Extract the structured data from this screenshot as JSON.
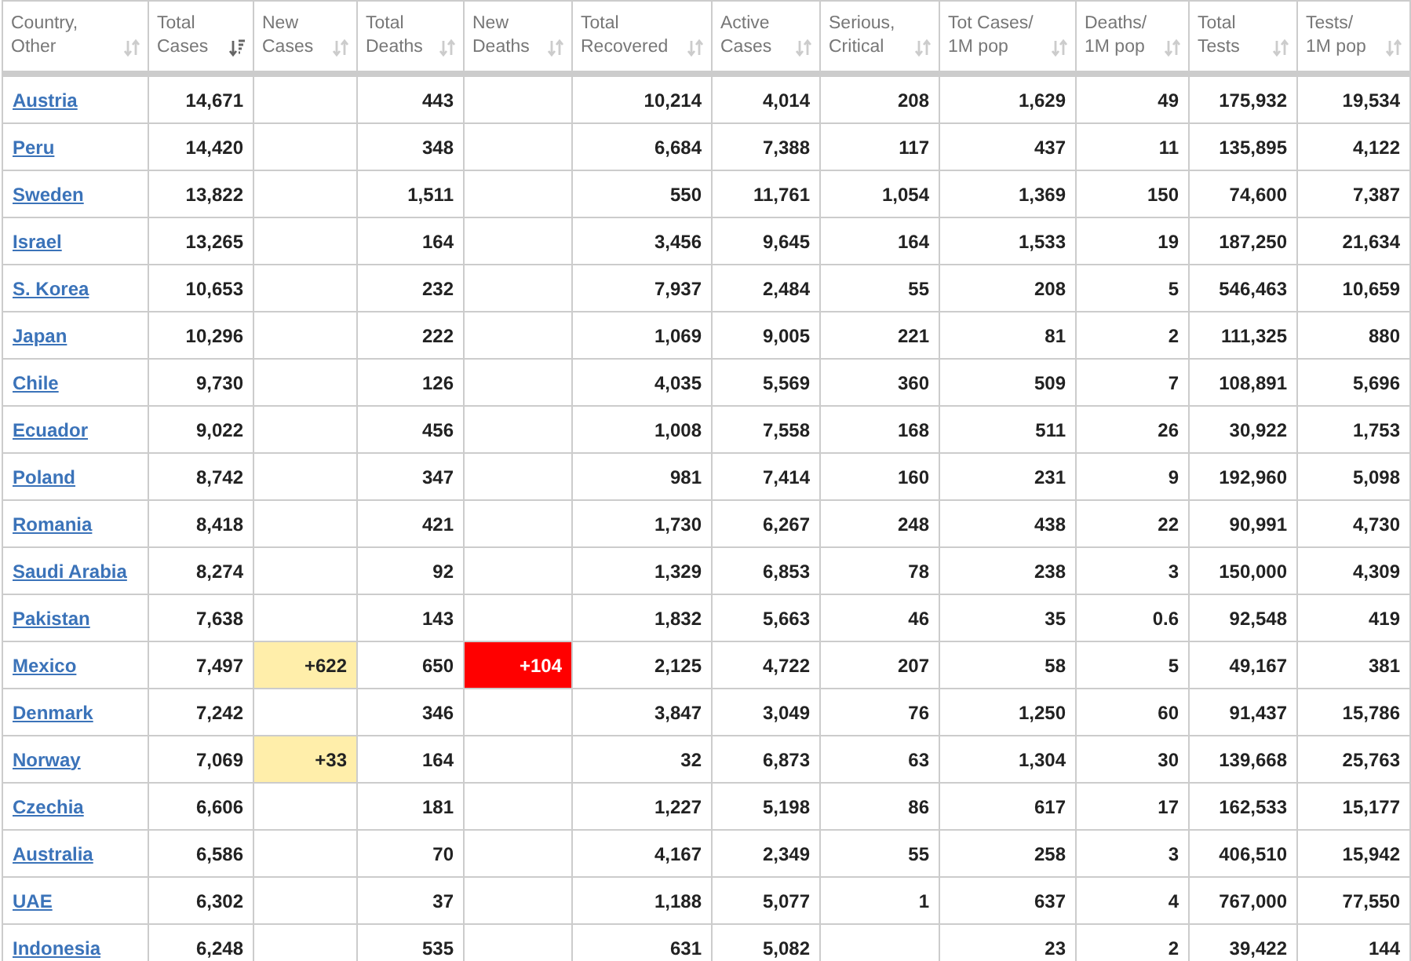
{
  "table": {
    "columns": [
      {
        "lines": [
          "Country,",
          "Other"
        ],
        "sorted": false
      },
      {
        "lines": [
          "Total",
          "Cases"
        ],
        "sorted": true
      },
      {
        "lines": [
          "New",
          "Cases"
        ],
        "sorted": false
      },
      {
        "lines": [
          "Total",
          "Deaths"
        ],
        "sorted": false
      },
      {
        "lines": [
          "New",
          "Deaths"
        ],
        "sorted": false
      },
      {
        "lines": [
          "Total",
          "Recovered"
        ],
        "sorted": false
      },
      {
        "lines": [
          "Active",
          "Cases"
        ],
        "sorted": false
      },
      {
        "lines": [
          "Serious,",
          "Critical"
        ],
        "sorted": false
      },
      {
        "lines": [
          "Tot Cases/",
          "1M pop"
        ],
        "sorted": false
      },
      {
        "lines": [
          "Deaths/",
          "1M pop"
        ],
        "sorted": false
      },
      {
        "lines": [
          "Total",
          "Tests"
        ],
        "sorted": false
      },
      {
        "lines": [
          "Tests/",
          "1M pop"
        ],
        "sorted": false
      }
    ],
    "rows": [
      {
        "country": "Austria",
        "total_cases": "14,671",
        "total_deaths": "443",
        "total_recovered": "10,214",
        "active_cases": "4,014",
        "serious_critical": "208",
        "tot_cases_per_1m": "1,629",
        "deaths_per_1m": "49",
        "total_tests": "175,932",
        "tests_per_1m": "19,534"
      },
      {
        "country": "Peru",
        "total_cases": "14,420",
        "total_deaths": "348",
        "total_recovered": "6,684",
        "active_cases": "7,388",
        "serious_critical": "117",
        "tot_cases_per_1m": "437",
        "deaths_per_1m": "11",
        "total_tests": "135,895",
        "tests_per_1m": "4,122"
      },
      {
        "country": "Sweden",
        "total_cases": "13,822",
        "total_deaths": "1,511",
        "total_recovered": "550",
        "active_cases": "11,761",
        "serious_critical": "1,054",
        "tot_cases_per_1m": "1,369",
        "deaths_per_1m": "150",
        "total_tests": "74,600",
        "tests_per_1m": "7,387"
      },
      {
        "country": "Israel",
        "total_cases": "13,265",
        "total_deaths": "164",
        "total_recovered": "3,456",
        "active_cases": "9,645",
        "serious_critical": "164",
        "tot_cases_per_1m": "1,533",
        "deaths_per_1m": "19",
        "total_tests": "187,250",
        "tests_per_1m": "21,634"
      },
      {
        "country": "S. Korea",
        "total_cases": "10,653",
        "total_deaths": "232",
        "total_recovered": "7,937",
        "active_cases": "2,484",
        "serious_critical": "55",
        "tot_cases_per_1m": "208",
        "deaths_per_1m": "5",
        "total_tests": "546,463",
        "tests_per_1m": "10,659"
      },
      {
        "country": "Japan",
        "total_cases": "10,296",
        "total_deaths": "222",
        "total_recovered": "1,069",
        "active_cases": "9,005",
        "serious_critical": "221",
        "tot_cases_per_1m": "81",
        "deaths_per_1m": "2",
        "total_tests": "111,325",
        "tests_per_1m": "880"
      },
      {
        "country": "Chile",
        "total_cases": "9,730",
        "total_deaths": "126",
        "total_recovered": "4,035",
        "active_cases": "5,569",
        "serious_critical": "360",
        "tot_cases_per_1m": "509",
        "deaths_per_1m": "7",
        "total_tests": "108,891",
        "tests_per_1m": "5,696"
      },
      {
        "country": "Ecuador",
        "total_cases": "9,022",
        "total_deaths": "456",
        "total_recovered": "1,008",
        "active_cases": "7,558",
        "serious_critical": "168",
        "tot_cases_per_1m": "511",
        "deaths_per_1m": "26",
        "total_tests": "30,922",
        "tests_per_1m": "1,753"
      },
      {
        "country": "Poland",
        "total_cases": "8,742",
        "total_deaths": "347",
        "total_recovered": "981",
        "active_cases": "7,414",
        "serious_critical": "160",
        "tot_cases_per_1m": "231",
        "deaths_per_1m": "9",
        "total_tests": "192,960",
        "tests_per_1m": "5,098"
      },
      {
        "country": "Romania",
        "total_cases": "8,418",
        "total_deaths": "421",
        "total_recovered": "1,730",
        "active_cases": "6,267",
        "serious_critical": "248",
        "tot_cases_per_1m": "438",
        "deaths_per_1m": "22",
        "total_tests": "90,991",
        "tests_per_1m": "4,730"
      },
      {
        "country": "Saudi Arabia",
        "total_cases": "8,274",
        "total_deaths": "92",
        "total_recovered": "1,329",
        "active_cases": "6,853",
        "serious_critical": "78",
        "tot_cases_per_1m": "238",
        "deaths_per_1m": "3",
        "total_tests": "150,000",
        "tests_per_1m": "4,309"
      },
      {
        "country": "Pakistan",
        "total_cases": "7,638",
        "total_deaths": "143",
        "total_recovered": "1,832",
        "active_cases": "5,663",
        "serious_critical": "46",
        "tot_cases_per_1m": "35",
        "deaths_per_1m": "0.6",
        "total_tests": "92,548",
        "tests_per_1m": "419"
      },
      {
        "country": "Mexico",
        "total_cases": "7,497",
        "new_cases": "+622",
        "total_deaths": "650",
        "new_deaths": "+104",
        "total_recovered": "2,125",
        "active_cases": "4,722",
        "serious_critical": "207",
        "tot_cases_per_1m": "58",
        "deaths_per_1m": "5",
        "total_tests": "49,167",
        "tests_per_1m": "381"
      },
      {
        "country": "Denmark",
        "total_cases": "7,242",
        "total_deaths": "346",
        "total_recovered": "3,847",
        "active_cases": "3,049",
        "serious_critical": "76",
        "tot_cases_per_1m": "1,250",
        "deaths_per_1m": "60",
        "total_tests": "91,437",
        "tests_per_1m": "15,786"
      },
      {
        "country": "Norway",
        "total_cases": "7,069",
        "new_cases": "+33",
        "total_deaths": "164",
        "total_recovered": "32",
        "active_cases": "6,873",
        "serious_critical": "63",
        "tot_cases_per_1m": "1,304",
        "deaths_per_1m": "30",
        "total_tests": "139,668",
        "tests_per_1m": "25,763"
      },
      {
        "country": "Czechia",
        "total_cases": "6,606",
        "total_deaths": "181",
        "total_recovered": "1,227",
        "active_cases": "5,198",
        "serious_critical": "86",
        "tot_cases_per_1m": "617",
        "deaths_per_1m": "17",
        "total_tests": "162,533",
        "tests_per_1m": "15,177"
      },
      {
        "country": "Australia",
        "total_cases": "6,586",
        "total_deaths": "70",
        "total_recovered": "4,167",
        "active_cases": "2,349",
        "serious_critical": "55",
        "tot_cases_per_1m": "258",
        "deaths_per_1m": "3",
        "total_tests": "406,510",
        "tests_per_1m": "15,942"
      },
      {
        "country": "UAE",
        "total_cases": "6,302",
        "total_deaths": "37",
        "total_recovered": "1,188",
        "active_cases": "5,077",
        "serious_critical": "1",
        "tot_cases_per_1m": "637",
        "deaths_per_1m": "4",
        "total_tests": "767,000",
        "tests_per_1m": "77,550"
      },
      {
        "country": "Indonesia",
        "total_cases": "6,248",
        "total_deaths": "535",
        "total_recovered": "631",
        "active_cases": "5,082",
        "tot_cases_per_1m": "23",
        "deaths_per_1m": "2",
        "total_tests": "39,422",
        "tests_per_1m": "144"
      }
    ]
  }
}
